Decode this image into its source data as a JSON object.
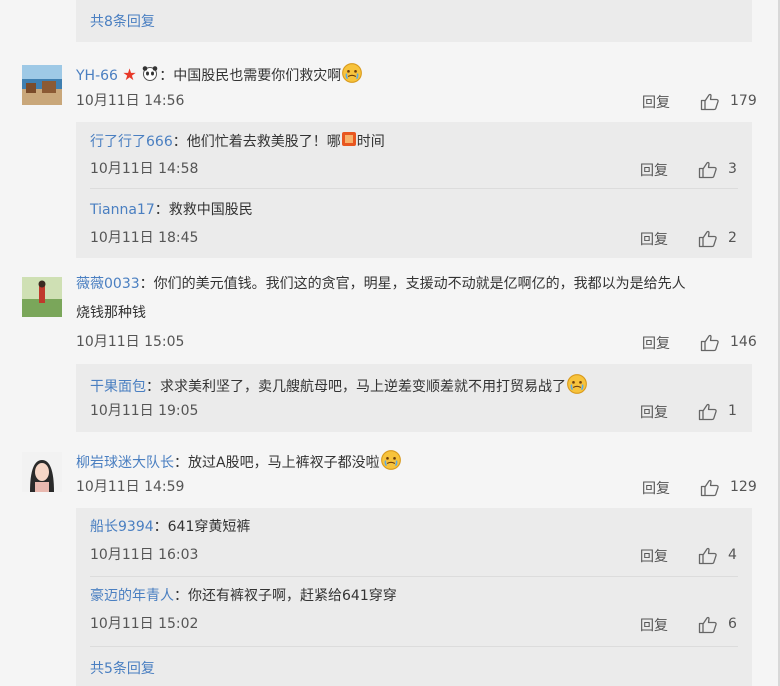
{
  "top_more": "共8条回复",
  "bottom_more": "共5条回复",
  "reply_label": "回复",
  "comments": [
    {
      "user": "YH-66",
      "badges": [
        "star-badge",
        "panda-badge"
      ],
      "colon": "：",
      "text": "中国股民也需要你们救灾啊",
      "emoji": "crying-laugh-emoji",
      "date": "10月11日 14:56",
      "likes": "179",
      "replies": [
        {
          "user": "行了行了666",
          "colon": "：",
          "text_a": "他们忙着去救美股了！哪",
          "icon": "emoji-box-icon",
          "text_b": "时间",
          "date": "10月11日 14:58",
          "likes": "3"
        },
        {
          "user": "Tianna17",
          "colon": "：",
          "text": "救救中国股民",
          "date": "10月11日 18:45",
          "likes": "2"
        }
      ]
    },
    {
      "user": "薇薇0033",
      "colon": "：",
      "text": "你们的美元值钱。我们这的贪官，明星，支援动不动就是亿啊亿的，我都以为是给先人",
      "text_line2": "烧钱那种钱",
      "date": "10月11日 15:05",
      "likes": "146",
      "replies": [
        {
          "user": "干果面包",
          "colon": "：",
          "text": "求求美利坚了，卖几艘航母吧，马上逆差变顺差就不用打贸易战了",
          "emoji": "worried-emoji",
          "date": "10月11日 19:05",
          "likes": "1"
        }
      ]
    },
    {
      "user": "柳岩球迷大队长",
      "colon": "：",
      "text": "放过A股吧，马上裤衩子都没啦",
      "emoji": "crying-emoji",
      "date": "10月11日 14:59",
      "likes": "129",
      "replies": [
        {
          "user": "船长9394",
          "colon": "：",
          "text": "641穿黄短裤",
          "date": "10月11日 16:03",
          "likes": "4"
        },
        {
          "user": "豪迈的年青人",
          "colon": "：",
          "text": "你还有裤衩子啊，赶紧给641穿穿",
          "date": "10月11日 15:02",
          "likes": "6"
        }
      ]
    }
  ]
}
